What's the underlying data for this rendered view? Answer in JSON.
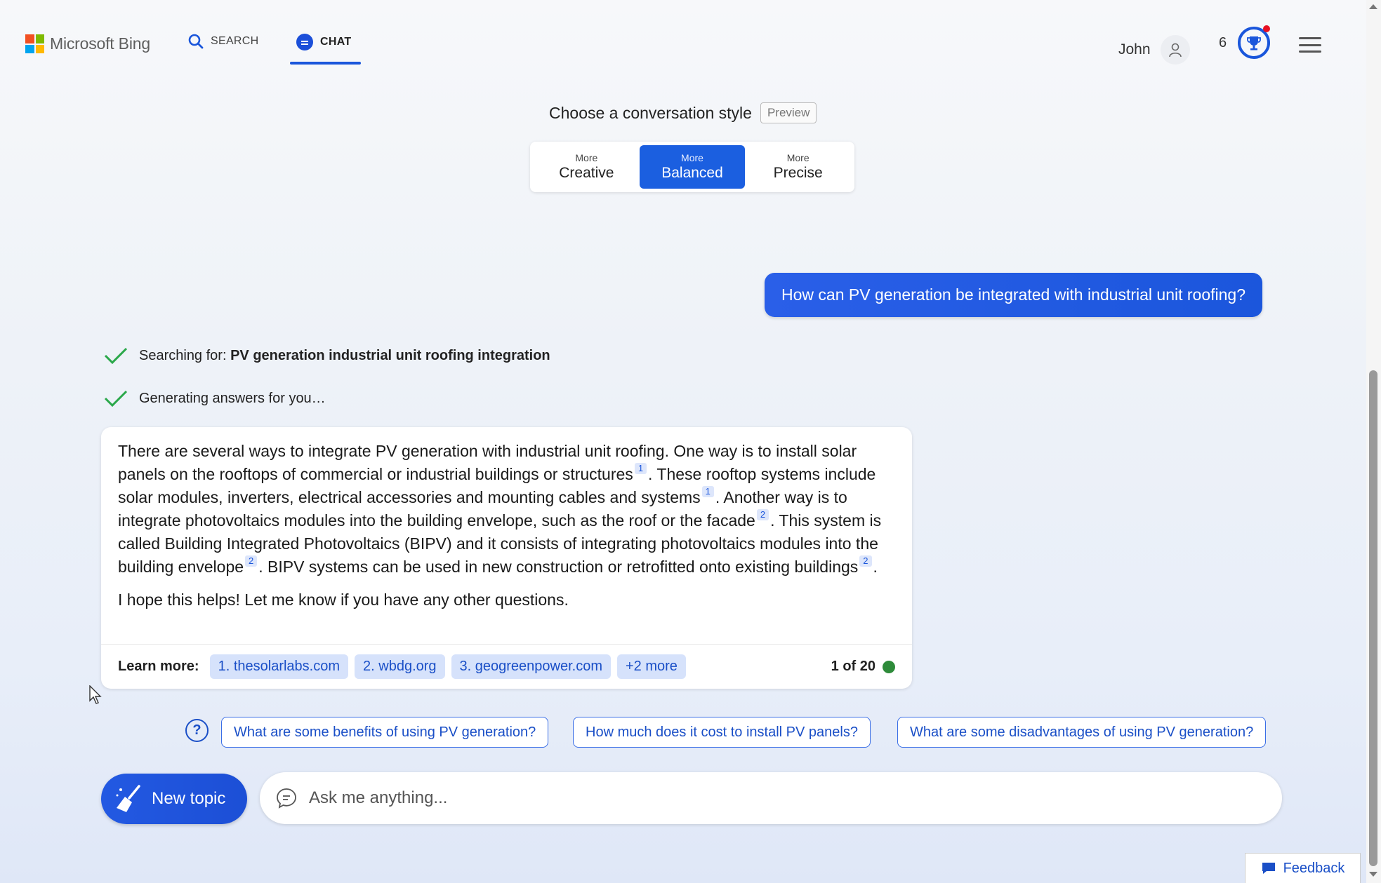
{
  "header": {
    "brand": "Microsoft Bing",
    "nav": {
      "search": "SEARCH",
      "chat": "CHAT"
    },
    "user_name": "John",
    "rewards_count": "6"
  },
  "style_picker": {
    "title": "Choose a conversation style",
    "badge": "Preview",
    "options": [
      {
        "small": "More",
        "big": "Creative",
        "active": false
      },
      {
        "small": "More",
        "big": "Balanced",
        "active": true
      },
      {
        "small": "More",
        "big": "Precise",
        "active": false
      }
    ]
  },
  "conversation": {
    "user_message": "How can PV generation be integrated with industrial unit roofing?",
    "status": [
      {
        "prefix": "Searching for: ",
        "bold": "PV generation industrial unit roofing integration"
      },
      {
        "prefix": "Generating answers for you…",
        "bold": ""
      }
    ],
    "answer": {
      "p1": [
        "There are several ways to integrate PV generation with industrial unit roofing. One way is to install solar panels on the rooftops of commercial or industrial buildings or structures",
        ". These rooftop systems include solar modules, inverters, electrical accessories and mounting cables and systems",
        ". Another way is to integrate photovoltaics modules into the building envelope, such as the roof or the facade",
        ". This system is called Building Integrated Photovoltaics (BIPV) and it consists of integrating photovoltaics modules into the building envelope",
        ". BIPV systems can be used in new construction or retrofitted onto existing buildings",
        "."
      ],
      "citations": [
        "1",
        "1",
        "2",
        "2",
        "2"
      ],
      "p2": "I hope this helps! Let me know if you have any other questions.",
      "learn_more_label": "Learn more:",
      "sources": [
        "1. thesolarlabs.com",
        "2. wbdg.org",
        "3. geogreenpower.com",
        "+2 more"
      ],
      "counter": "1 of 20"
    },
    "suggestions": [
      "What are some benefits of using PV generation?",
      "How much does it cost to install PV panels?",
      "What are some disadvantages of using PV generation?"
    ]
  },
  "composer": {
    "new_topic": "New topic",
    "placeholder": "Ask me anything..."
  },
  "feedback": "Feedback",
  "colors": {
    "accent": "#1b5fe0",
    "link": "#1a4fc7",
    "status_check": "#2aa84a",
    "counter_dot": "#2e8b3a",
    "notification": "#e81123"
  }
}
